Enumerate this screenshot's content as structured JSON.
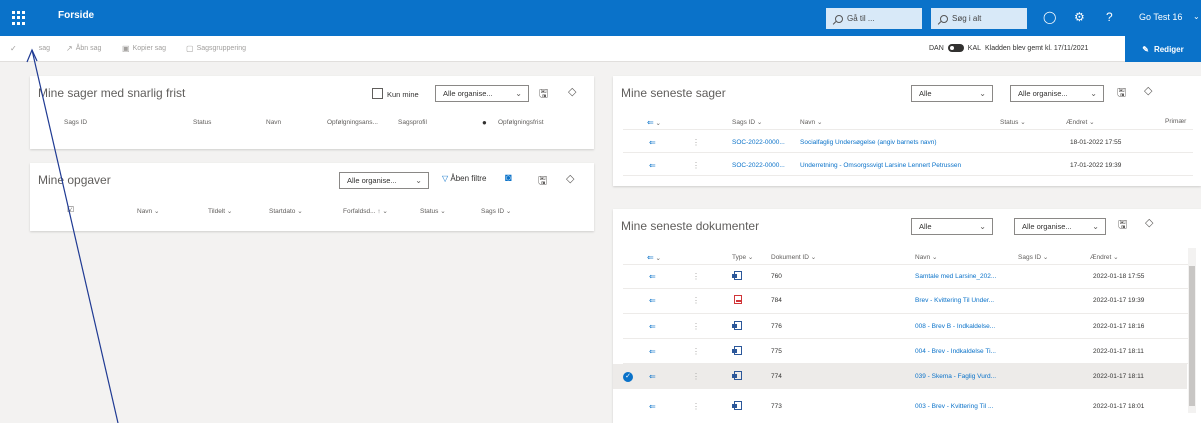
{
  "topbar": {
    "app_title": "Forside",
    "goto_placeholder": "Gå til ...",
    "search_placeholder": "Søg i alt",
    "user_name": "Go Test 16"
  },
  "commands": {
    "new_case": "sag",
    "open_case": "Åbn sag",
    "copy_case": "Kopier sag",
    "case_grouping": "Sagsgruppering"
  },
  "status": {
    "lang_left": "DAN",
    "lang_right": "KAL",
    "saved_text": "Kladden blev gemt kl. 17/11/2021",
    "edit_label": "Rediger"
  },
  "deadline_cases": {
    "title": "Mine sager med snarlig frist",
    "only_mine": "Kun mine",
    "org_filter": "Alle organise...",
    "columns": [
      "Sags ID",
      "Status",
      "Navn",
      "Opfølgningsans...",
      "Sagsprofil",
      "Opfølgningsfrist"
    ]
  },
  "tasks": {
    "title": "Mine opgaver",
    "org_filter": "Alle organise...",
    "open_filters": "Åben filtre",
    "columns": [
      "Navn",
      "Tildelt",
      "Startdato",
      "Forfaldsd...",
      "Status",
      "Sags ID"
    ]
  },
  "recent_cases": {
    "title": "Mine seneste sager",
    "filter_all": "Alle",
    "org_filter": "Alle organise...",
    "columns": [
      "Sags ID",
      "Navn",
      "Status",
      "Ændret",
      "Primær"
    ],
    "rows": [
      {
        "id": "SOC-2022-0000...",
        "name": "Socialfaglig Undersøgelse (angiv barnets navn)",
        "changed": "18-01-2022 17:55"
      },
      {
        "id": "SOC-2022-0000...",
        "name": "Underretning - Omsorgssvigt Larsine Lennert Petrussen",
        "changed": "17-01-2022 19:39"
      }
    ]
  },
  "recent_docs": {
    "title": "Mine seneste dokumenter",
    "filter_all": "Alle",
    "org_filter": "Alle organise...",
    "columns": [
      "Type",
      "Dokument ID",
      "Navn",
      "Sags ID",
      "Ændret"
    ],
    "rows": [
      {
        "type": "word",
        "id": "760",
        "name": "Samtale med Larsine_202...",
        "changed": "2022-01-18 17:55"
      },
      {
        "type": "pdf",
        "id": "784",
        "name": "Brev - Kvittering Til Under...",
        "changed": "2022-01-17 19:39"
      },
      {
        "type": "word",
        "id": "776",
        "name": "008 - Brev B - Indkaldelse...",
        "changed": "2022-01-17 18:16"
      },
      {
        "type": "word",
        "id": "775",
        "name": "004 - Brev - Indkaldelse Ti...",
        "changed": "2022-01-17 18:11"
      },
      {
        "type": "word",
        "id": "774",
        "name": "039 - Skema - Faglig Vurd...",
        "changed": "2022-01-17 18:11",
        "selected": true
      },
      {
        "type": "word",
        "id": "773",
        "name": "003 - Brev - Kvittering Til ...",
        "changed": "2022-01-17 18:01"
      }
    ]
  },
  "colors": {
    "brand": "#0a72c9",
    "selected_row": "#edebe9"
  }
}
